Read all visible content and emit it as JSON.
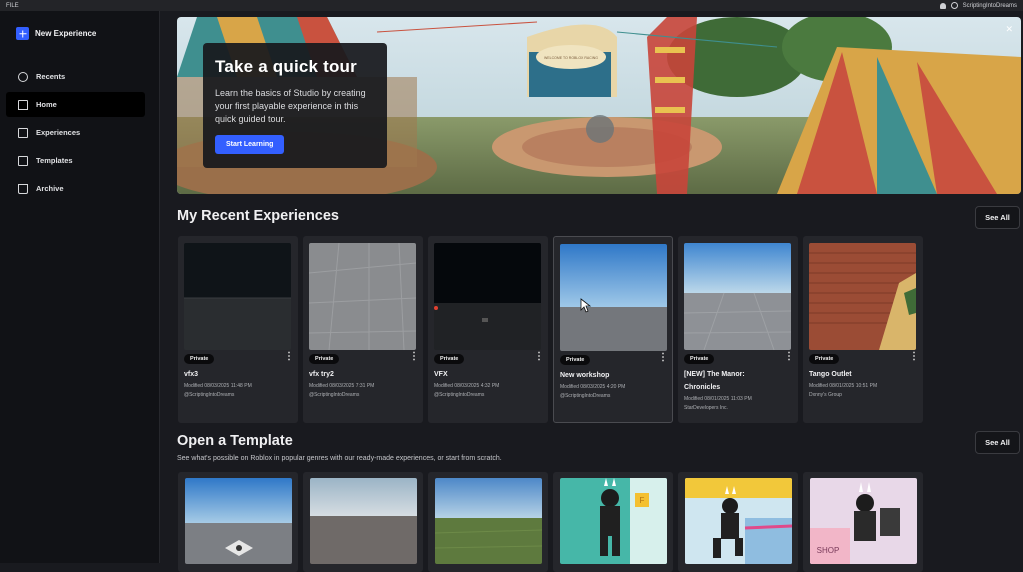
{
  "topbar": {
    "menu_file": "FILE",
    "username": "ScriptingIntoDreams"
  },
  "sidebar": {
    "new_experience": "New Experience",
    "items": [
      {
        "label": "Recents",
        "icon": "clock-icon"
      },
      {
        "label": "Home",
        "icon": "home-icon",
        "active": true
      },
      {
        "label": "Experiences",
        "icon": "folder-icon"
      },
      {
        "label": "Templates",
        "icon": "template-icon"
      },
      {
        "label": "Archive",
        "icon": "archive-icon"
      }
    ]
  },
  "hero": {
    "title": "Take a quick tour",
    "description": "Learn the basics of Studio by creating your first playable experience in this quick guided tour.",
    "button": "Start Learning",
    "close": "✕",
    "sign_text": "WELCOME TO ROBLOX RACING"
  },
  "recent": {
    "title": "My Recent Experiences",
    "see_all": "See All",
    "items": [
      {
        "badge": "Private",
        "name": "vfx3",
        "modified": "Modified 08/03/2025 11:48 PM",
        "creator": "@ScriptingIntoDreams"
      },
      {
        "badge": "Private",
        "name": "vfx try2",
        "modified": "Modified 08/03/2025 7:31 PM",
        "creator": "@ScriptingIntoDreams"
      },
      {
        "badge": "Private",
        "name": "VFX",
        "modified": "Modified 08/03/2025 4:32 PM",
        "creator": "@ScriptingIntoDreams"
      },
      {
        "badge": "Private",
        "name": "New workshop",
        "modified": "Modified 08/03/2025 4:20 PM",
        "creator": "@ScriptingIntoDreams"
      },
      {
        "badge": "Private",
        "name": "[NEW] The Manor: Chronicles",
        "modified": "Modified 08/01/2025 11:03 PM",
        "creator": "StarDevelopers Inc."
      },
      {
        "badge": "Private",
        "name": "Tango Outlet",
        "modified": "Modified 08/01/2025 10:51 PM",
        "creator": "Dxnny's Group"
      }
    ]
  },
  "templates": {
    "title": "Open a Template",
    "see_all": "See All",
    "subtitle": "See what's possible on Roblox in popular genres with our ready-made experiences, or start from scratch.",
    "thumb_shop_label": "SHOP"
  },
  "colors": {
    "accent": "#335fff",
    "background": "#191a1f",
    "sidebar": "#111216",
    "card": "#25262b"
  }
}
